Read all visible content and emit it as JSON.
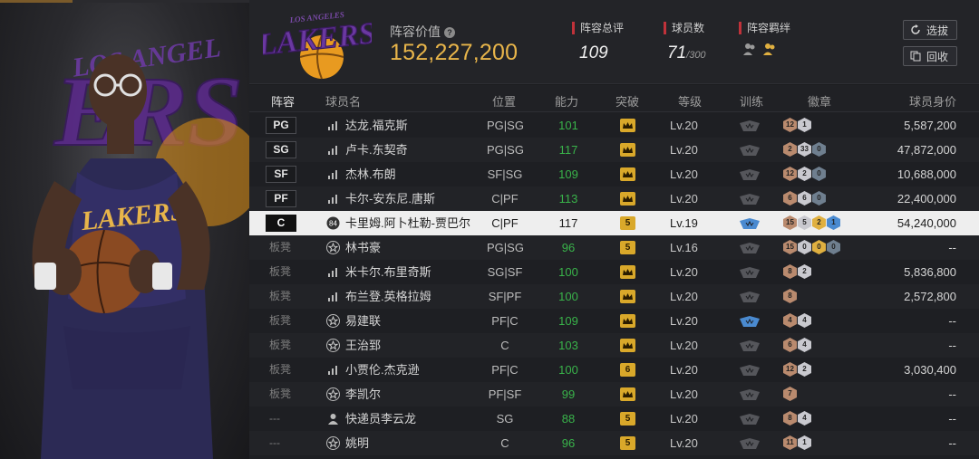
{
  "header": {
    "value_label": "阵容价值",
    "value": "152,227,200",
    "total_rating_label": "阵容总评",
    "total_rating": "109",
    "player_count_label": "球员数",
    "player_count": "71",
    "player_count_max": "/300",
    "bond_label": "阵容羁绊",
    "pick_button": "选拔",
    "recycle_button": "回收",
    "logo_text": "LAKERS"
  },
  "columns": [
    "阵容",
    "球员名",
    "位置",
    "能力",
    "突破",
    "等级",
    "训练",
    "徽章",
    "球员身价"
  ],
  "rows": [
    {
      "slot": "PG",
      "bench": false,
      "icon": "signal-icon",
      "name": "达龙.福克斯",
      "pos": "PG|SG",
      "ability": "101",
      "breakthrough": "crown",
      "level": "Lv.20",
      "train": "gray",
      "badges": [
        {
          "color": "#b98a6e",
          "num": "12"
        },
        {
          "color": "#c9c9cf",
          "num": "1"
        }
      ],
      "value": "5,587,200",
      "selected": false
    },
    {
      "slot": "SG",
      "bench": false,
      "icon": "signal-icon",
      "name": "卢卡.东契奇",
      "pos": "PG|SG",
      "ability": "117",
      "breakthrough": "crown",
      "level": "Lv.20",
      "train": "gray",
      "badges": [
        {
          "color": "#b98a6e",
          "num": "2"
        },
        {
          "color": "#c9c9cf",
          "num": "33"
        },
        {
          "color": "#6f7f8f",
          "num": "0"
        }
      ],
      "value": "47,872,000",
      "selected": false
    },
    {
      "slot": "SF",
      "bench": false,
      "icon": "signal-icon",
      "name": "杰林.布朗",
      "pos": "SF|SG",
      "ability": "109",
      "breakthrough": "crown",
      "level": "Lv.20",
      "train": "gray",
      "badges": [
        {
          "color": "#b98a6e",
          "num": "12"
        },
        {
          "color": "#c9c9cf",
          "num": "2"
        },
        {
          "color": "#6f7f8f",
          "num": "0"
        }
      ],
      "value": "10,688,000",
      "selected": false
    },
    {
      "slot": "PF",
      "bench": false,
      "icon": "signal-icon",
      "name": "卡尔-安东尼.唐斯",
      "pos": "C|PF",
      "ability": "113",
      "breakthrough": "crown",
      "level": "Lv.20",
      "train": "gray",
      "badges": [
        {
          "color": "#b98a6e",
          "num": "6"
        },
        {
          "color": "#c9c9cf",
          "num": "6"
        },
        {
          "color": "#6f7f8f",
          "num": "0"
        }
      ],
      "value": "22,400,000",
      "selected": false
    },
    {
      "slot": "C",
      "bench": false,
      "icon": "number-84-icon",
      "icon_text": "84",
      "name": "卡里姆.阿卜杜勒-贾巴尔",
      "pos": "C|PF",
      "ability": "117",
      "breakthrough": "5",
      "level": "Lv.19",
      "train": "blue",
      "badges": [
        {
          "color": "#b98a6e",
          "num": "15"
        },
        {
          "color": "#c9c9cf",
          "num": "5"
        },
        {
          "color": "#e0b040",
          "num": "2"
        },
        {
          "color": "#4a8ad0",
          "num": "1"
        }
      ],
      "value": "54,240,000",
      "selected": true
    },
    {
      "slot": "板凳",
      "bench": true,
      "icon": "star-icon",
      "name": "林书豪",
      "pos": "PG|SG",
      "ability": "96",
      "breakthrough": "5",
      "level": "Lv.16",
      "train": "gray",
      "badges": [
        {
          "color": "#b98a6e",
          "num": "15"
        },
        {
          "color": "#c9c9cf",
          "num": "0"
        },
        {
          "color": "#e0b040",
          "num": "0"
        },
        {
          "color": "#6f7f8f",
          "num": "0"
        }
      ],
      "value": "--",
      "selected": false
    },
    {
      "slot": "板凳",
      "bench": true,
      "icon": "signal-icon",
      "name": "米卡尔.布里奇斯",
      "pos": "SG|SF",
      "ability": "100",
      "breakthrough": "crown",
      "level": "Lv.20",
      "train": "gray",
      "badges": [
        {
          "color": "#b98a6e",
          "num": "8"
        },
        {
          "color": "#c9c9cf",
          "num": "2"
        }
      ],
      "value": "5,836,800",
      "selected": false
    },
    {
      "slot": "板凳",
      "bench": true,
      "icon": "signal-icon",
      "name": "布兰登.英格拉姆",
      "pos": "SF|PF",
      "ability": "100",
      "breakthrough": "crown",
      "level": "Lv.20",
      "train": "gray",
      "badges": [
        {
          "color": "#b98a6e",
          "num": "8"
        }
      ],
      "value": "2,572,800",
      "selected": false
    },
    {
      "slot": "板凳",
      "bench": true,
      "icon": "star-icon",
      "name": "易建联",
      "pos": "PF|C",
      "ability": "109",
      "breakthrough": "crown",
      "level": "Lv.20",
      "train": "blue",
      "badges": [
        {
          "color": "#b98a6e",
          "num": "4"
        },
        {
          "color": "#c9c9cf",
          "num": "4"
        }
      ],
      "value": "--",
      "selected": false
    },
    {
      "slot": "板凳",
      "bench": true,
      "icon": "star-icon",
      "name": "王治郅",
      "pos": "C",
      "ability": "103",
      "breakthrough": "crown",
      "level": "Lv.20",
      "train": "gray",
      "badges": [
        {
          "color": "#b98a6e",
          "num": "6"
        },
        {
          "color": "#c9c9cf",
          "num": "4"
        }
      ],
      "value": "--",
      "selected": false
    },
    {
      "slot": "板凳",
      "bench": true,
      "icon": "signal-icon",
      "name": "小贾伦.杰克逊",
      "pos": "PF|C",
      "ability": "100",
      "breakthrough": "6",
      "level": "Lv.20",
      "train": "gray",
      "badges": [
        {
          "color": "#b98a6e",
          "num": "12"
        },
        {
          "color": "#c9c9cf",
          "num": "2"
        }
      ],
      "value": "3,030,400",
      "selected": false
    },
    {
      "slot": "板凳",
      "bench": true,
      "icon": "star-icon",
      "name": "李凯尔",
      "pos": "PF|SF",
      "ability": "99",
      "breakthrough": "crown",
      "level": "Lv.20",
      "train": "gray",
      "badges": [
        {
          "color": "#b98a6e",
          "num": "7"
        }
      ],
      "value": "--",
      "selected": false
    },
    {
      "slot": "---",
      "bench": true,
      "icon": "person-icon",
      "name": "快递员李云龙",
      "pos": "SG",
      "ability": "88",
      "breakthrough": "5",
      "level": "Lv.20",
      "train": "gray",
      "badges": [
        {
          "color": "#b98a6e",
          "num": "8"
        },
        {
          "color": "#c9c9cf",
          "num": "4"
        }
      ],
      "value": "--",
      "selected": false
    },
    {
      "slot": "---",
      "bench": true,
      "icon": "star-icon",
      "name": "姚明",
      "pos": "C",
      "ability": "96",
      "breakthrough": "5",
      "level": "Lv.20",
      "train": "gray",
      "badges": [
        {
          "color": "#b98a6e",
          "num": "11"
        },
        {
          "color": "#c9c9cf",
          "num": "1"
        }
      ],
      "value": "--",
      "selected": false
    }
  ],
  "colors": {
    "accent_gold": "#e8b54a",
    "ability_green": "#39b34a",
    "breakthrough_gold": "#d9a82a",
    "lakers_purple": "#5a2a8a"
  }
}
